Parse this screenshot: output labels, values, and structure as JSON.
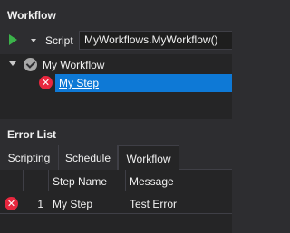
{
  "workflow_panel": {
    "title": "Workflow",
    "toolbar": {
      "run_icon": "play-icon",
      "mode_label": "Script",
      "script_value": "MyWorkflows.MyWorkflow()"
    },
    "tree": {
      "root": {
        "label": "My Workflow",
        "icon": "check-circle-icon",
        "expanded": true
      },
      "children": [
        {
          "label": "My Step",
          "icon": "error-icon",
          "selected": true
        }
      ]
    }
  },
  "error_list": {
    "title": "Error List",
    "tabs": [
      {
        "label": "Scripting",
        "active": false
      },
      {
        "label": "Schedule",
        "active": false
      },
      {
        "label": "Workflow",
        "active": true
      }
    ],
    "columns": [
      "",
      "",
      "Step Name",
      "Message"
    ],
    "rows": [
      {
        "icon": "error-icon",
        "index": "1",
        "step_name": "My Step",
        "message": "Test Error"
      }
    ]
  },
  "colors": {
    "background": "#2d2d30",
    "tree_background": "#252526",
    "selection": "#0e79d6",
    "run_green": "#3bb34a",
    "error_red": "#e8273e"
  }
}
